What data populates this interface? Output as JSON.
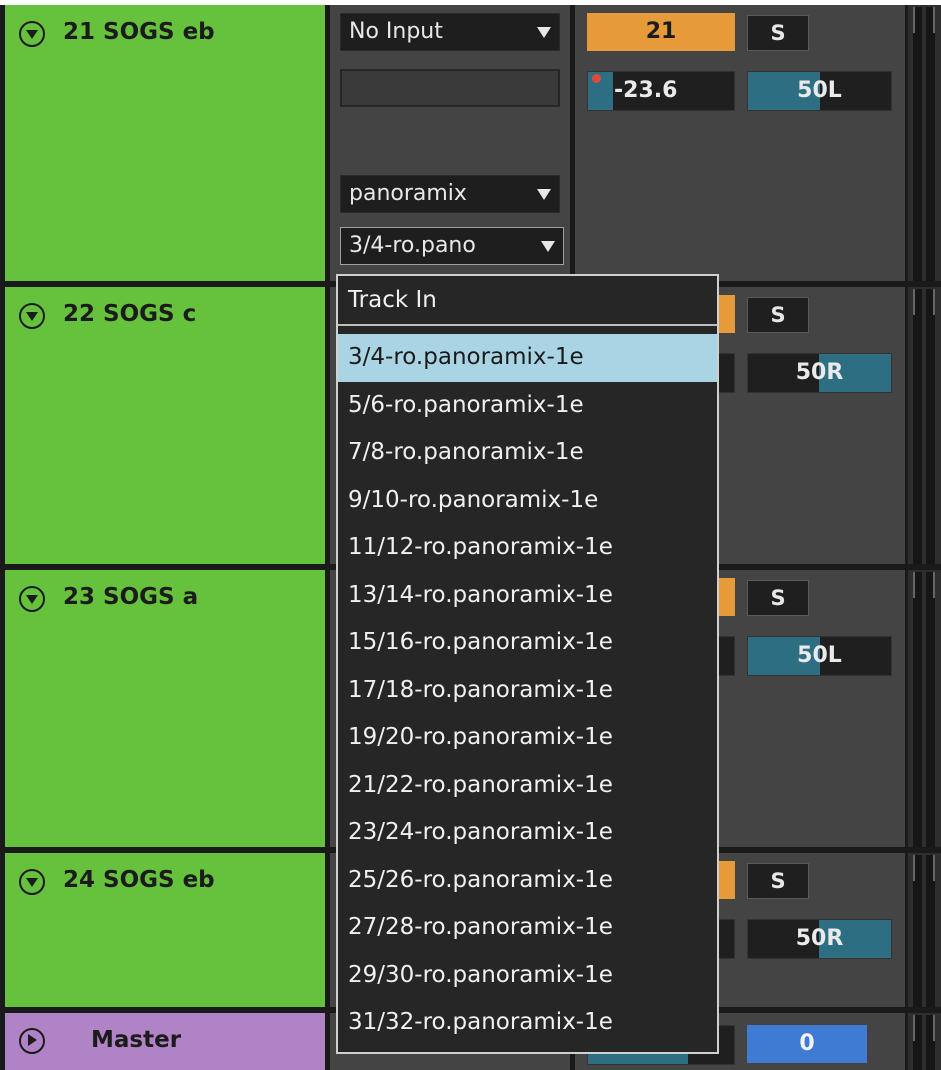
{
  "tracks": [
    {
      "name": "21 SOGS eb",
      "input_type": "No Input",
      "output_type": "panoramix",
      "output_channel": "3/4-ro.pano",
      "number": "21",
      "solo": "S",
      "volume": "-23.6",
      "pan": "50L"
    },
    {
      "name": "22 SOGS c",
      "solo": "S",
      "pan": "50R"
    },
    {
      "name": "23 SOGS a",
      "solo": "S",
      "pan": "50L"
    },
    {
      "name": "24 SOGS eb",
      "solo": "S",
      "pan": "50R"
    }
  ],
  "master": {
    "name": "Master",
    "value": "0"
  },
  "menu": {
    "header": "Track In",
    "selected_index": 0,
    "items": [
      "3/4-ro.panoramix-1e",
      "5/6-ro.panoramix-1e",
      "7/8-ro.panoramix-1e",
      "9/10-ro.panoramix-1e",
      "11/12-ro.panoramix-1e",
      "13/14-ro.panoramix-1e",
      "15/16-ro.panoramix-1e",
      "17/18-ro.panoramix-1e",
      "19/20-ro.panoramix-1e",
      "21/22-ro.panoramix-1e",
      "23/24-ro.panoramix-1e",
      "25/26-ro.panoramix-1e",
      "27/28-ro.panoramix-1e",
      "29/30-ro.panoramix-1e",
      "31/32-ro.panoramix-1e"
    ]
  },
  "colors": {
    "track_green": "#66c23c",
    "master_purple": "#b082c6",
    "track_number_orange": "#e69a3a",
    "master_number_blue": "#3f7bd2",
    "pan_fill_teal": "#2e6e82",
    "menu_selected": "#a9d4e4"
  },
  "icons": {
    "fold_open": "chevron-down-circle-icon",
    "fold_closed": "chevron-right-circle-icon",
    "dropdown": "triangle-down-icon",
    "clip": "clip-indicator-icon"
  }
}
